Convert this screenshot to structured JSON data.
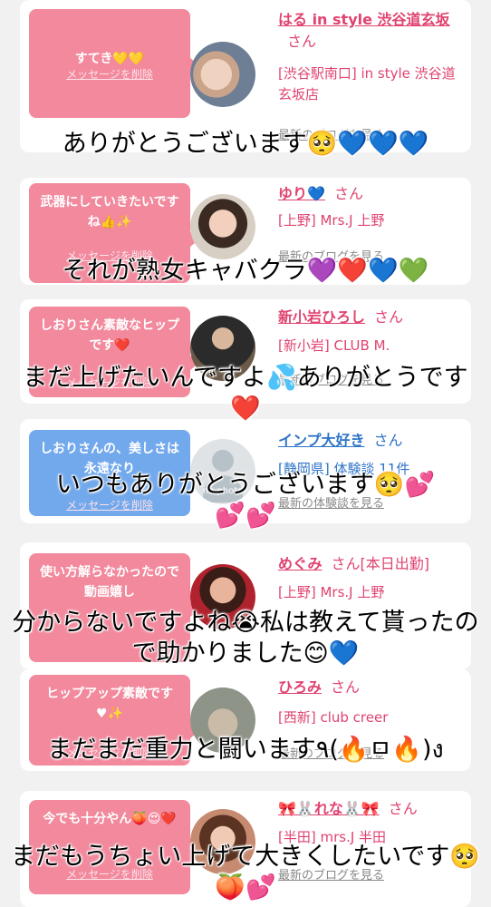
{
  "colors": {
    "accent_pink": "#f2899d",
    "accent_blue": "#72a9ec",
    "name_pink": "#e0436f",
    "name_blue": "#2f74c8"
  },
  "cards": [
    {
      "message": "すてき💛💛",
      "delete_label": "メッセージを削除",
      "name": "はる in style 渋谷道玄坂",
      "san": "さん",
      "shop": "[渋谷駅南口] in style 渋谷道玄坂店",
      "link": "最新のブログを見る",
      "caption": "ありがとうございます🥺💙💙💙"
    },
    {
      "message": "武器にしていきたいですね👍✨",
      "delete_label": "メッセージを削除",
      "name": "ゆり💙",
      "san": "さん",
      "shop": "[上野] Mrs.J 上野",
      "link": "最新のブログを見る",
      "caption": "それが熟女キャバクラ💜❤️💙💚"
    },
    {
      "message": "しおりさん素敵なヒップです❤️",
      "delete_label": "メッセージを削除",
      "name": "新小岩ひろし",
      "san": "さん",
      "shop": "[新小岩] CLUB M.",
      "link": "最新のブログを見る",
      "caption": "まだ上げたいんですよ💦ありがとうです❤️"
    },
    {
      "message": "しおりさんの、美しさは永遠なり",
      "delete_label": "メッセージを削除",
      "name": "インプ大好き",
      "san": "さん",
      "shop": "[静岡県] 体験談 11件",
      "link": "最新の体験談を見る",
      "avatar_label": "no photo",
      "caption": "いつもありがとうございます🥺💕💕💕"
    },
    {
      "message": "使い方解らなかったので動画嬉し",
      "delete_label": "メッセージを削除",
      "name": "めぐみ",
      "san": "さん[本日出勤]",
      "shop": "[上野] Mrs.J 上野",
      "link": "最新のブログを見る",
      "caption": "分からないですよね😭私は教えて貰ったので助かりました😊💙"
    },
    {
      "message": "ヒップアップ素敵です♥✨",
      "delete_label": "メッセージを削除",
      "name": "ひろみ",
      "san": "さん",
      "shop": "[西新] club creer",
      "link": "最新のブログを見る",
      "caption": "まだまだ重力と闘います٩(🔥ㅁ🔥)ง"
    },
    {
      "message": "今でも十分やん🍑😍❤️",
      "delete_label": "メッセージを削除",
      "name": "🎀🐰れな🐰🎀",
      "san": "さん",
      "shop": "[半田] mrs.J 半田",
      "link": "最新のブログを見る",
      "caption": "まだもうちょい上げて大きくしたいです🥺🍑💕"
    }
  ]
}
